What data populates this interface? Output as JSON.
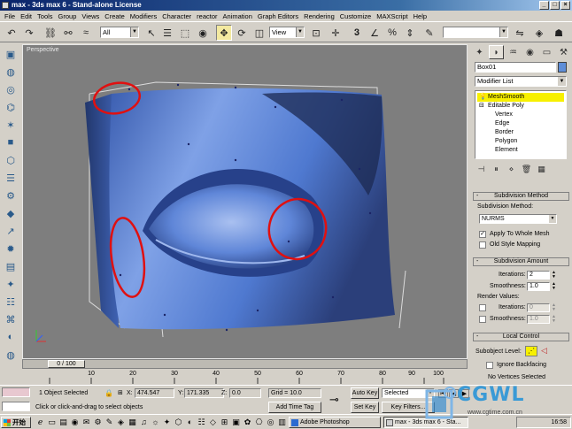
{
  "window": {
    "title": "max - 3ds max 6 - Stand-alone License",
    "controls": [
      "_",
      "□",
      "×"
    ]
  },
  "menu": [
    "File",
    "Edit",
    "Tools",
    "Group",
    "Views",
    "Create",
    "Modifiers",
    "Character",
    "reactor",
    "Animation",
    "Graph Editors",
    "Rendering",
    "Customize",
    "MAXScript",
    "Help"
  ],
  "toolbar": {
    "selection_filter": "All",
    "reference_coord": "View"
  },
  "viewport": {
    "label": "Perspective"
  },
  "timeline": {
    "slider": "0 / 100",
    "ticks": [
      "10",
      "20",
      "30",
      "40",
      "50",
      "60",
      "70",
      "80",
      "90",
      "100"
    ]
  },
  "command_panel": {
    "object_name": "Box01",
    "modifier_list": "Modifier List",
    "stack": [
      {
        "label": "MeshSmooth",
        "selected": true
      },
      {
        "label": "Editable Poly",
        "selected": false
      },
      {
        "label": "Vertex",
        "selected": false
      },
      {
        "label": "Edge",
        "selected": false
      },
      {
        "label": "Border",
        "selected": false
      },
      {
        "label": "Polygon",
        "selected": false
      },
      {
        "label": "Element",
        "selected": false
      }
    ],
    "subdivision_method": {
      "header": "Subdivision Method",
      "label": "Subdivision Method:",
      "value": "NURMS",
      "apply_whole_mesh": "Apply To Whole Mesh",
      "old_style": "Old Style Mapping"
    },
    "subdivision_amount": {
      "header": "Subdivision Amount",
      "iterations_label": "Iterations:",
      "iterations": "2",
      "smoothness_label": "Smoothness:",
      "smoothness": "1.0",
      "render_values": "Render Values:",
      "render_iterations": "0",
      "render_smoothness": "1.0"
    },
    "local_control": {
      "header": "Local Control",
      "sublevel_label": "Subobject Level:",
      "ignore_backfacing": "Ignore Backfacing",
      "cut_text": "No Vertices Selected"
    }
  },
  "status": {
    "selected": "1 Object Selected",
    "prompt": "Click or click-and-drag to select objects",
    "x_label": "X:",
    "x": "474.547",
    "y_label": "Y:",
    "y": "171.335",
    "z_label": "Z:",
    "z": "0.0",
    "grid": "Grid = 10.0",
    "add_time_tag": "Add Time Tag",
    "auto_key": "Auto Key",
    "set_key": "Set Key",
    "key_mode": "Selected",
    "key_filters": "Key Filters..."
  },
  "taskbar": {
    "start": "开始",
    "tasks": [
      {
        "label": "max - 3ds max 6 - Sta...",
        "active": true
      },
      {
        "label": "Adobe Photoshop",
        "active": false
      }
    ],
    "clock": "16:58"
  },
  "watermark": {
    "brand": "CGWL",
    "url": "www.cgtime.com.cn"
  }
}
